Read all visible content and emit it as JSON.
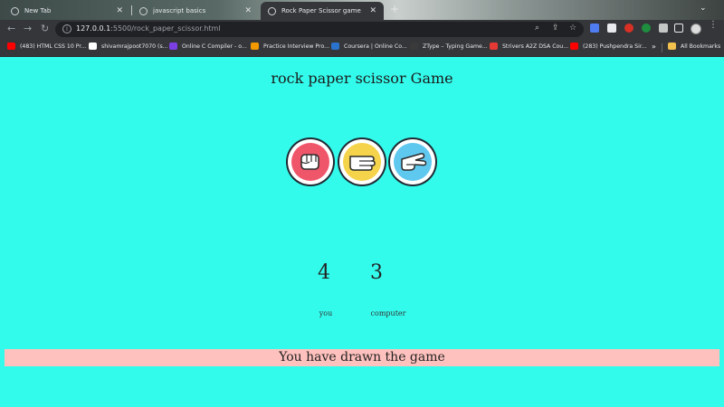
{
  "browser": {
    "tabs": [
      {
        "label": "New Tab"
      },
      {
        "label": "javascript basics"
      },
      {
        "label": "Rock Paper Scissor game"
      }
    ],
    "url": {
      "host": "127.0.0.1",
      "path": ":5500/rock_paper_scissor.html"
    },
    "bookmarks": [
      {
        "label": "(483) HTML CSS 10 Pr...",
        "color": "#ff0000"
      },
      {
        "label": "shivamrajpoot7070 (s...",
        "color": "#ffffff"
      },
      {
        "label": "Online C Compiler - o...",
        "color": "#7b3fe4"
      },
      {
        "label": "Practice Interview Pro...",
        "color": "#f29900"
      },
      {
        "label": "Coursera | Online Co...",
        "color": "#2a73cc"
      },
      {
        "label": "ZType – Typing Game...",
        "color": "#3a3a3a"
      },
      {
        "label": "Strivers A2Z DSA Cou...",
        "color": "#e53935"
      },
      {
        "label": "(283) Pushpendra Sir...",
        "color": "#ff0000"
      }
    ],
    "all_bookmarks": "All Bookmarks"
  },
  "game": {
    "title": "rock paper scissor Game",
    "choices": [
      {
        "name": "rock",
        "color": "#f0566a"
      },
      {
        "name": "paper",
        "color": "#f5d34a"
      },
      {
        "name": "scissors",
        "color": "#5fc8ef"
      }
    ],
    "user_score": "4",
    "comp_score": "3",
    "user_label": "you",
    "comp_label": "computer",
    "message": "You have drawn the game",
    "message_bg": "#ffc1bd",
    "page_bg": "#33fbec"
  }
}
